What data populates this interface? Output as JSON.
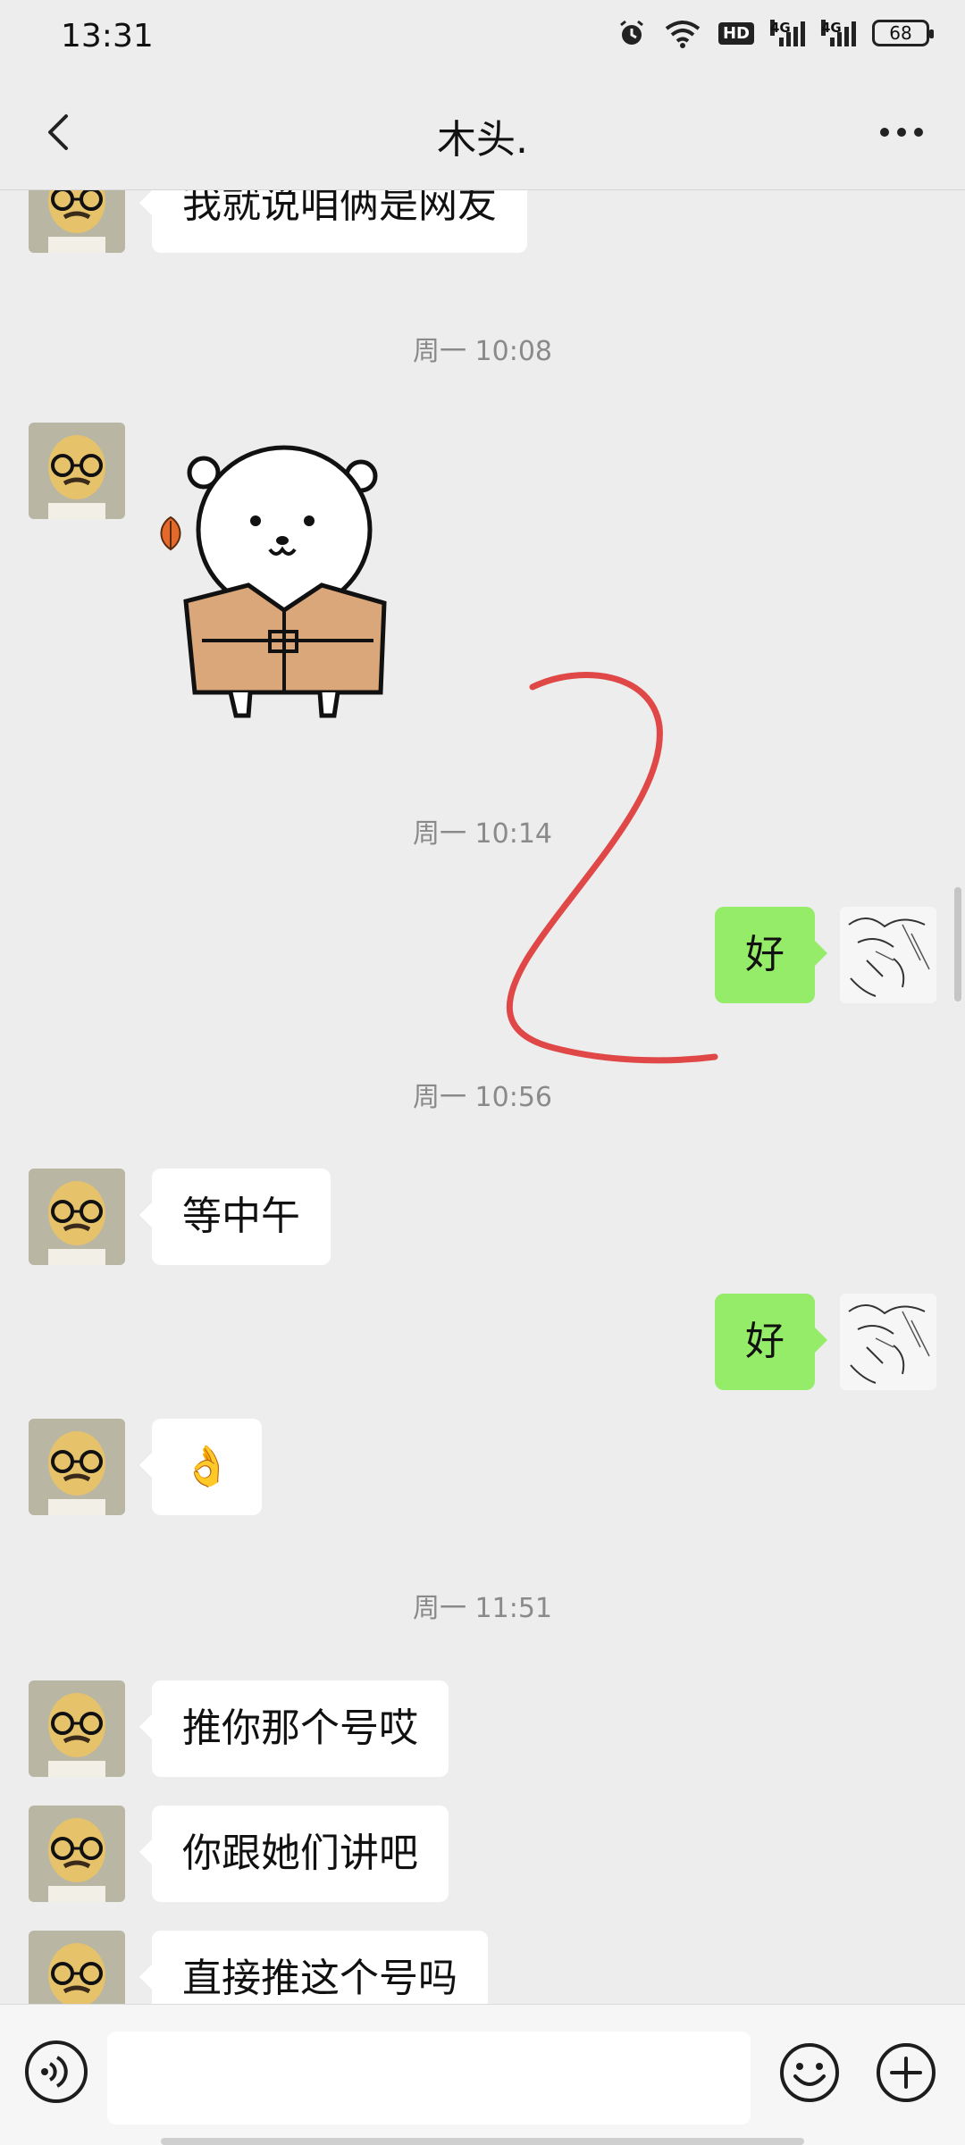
{
  "status": {
    "time": "13:31",
    "battery": "68",
    "hd_badge": "HD",
    "net_left": "4G",
    "net_right": "4G"
  },
  "nav": {
    "title": "木头."
  },
  "messages": [
    {
      "side": "left",
      "text": "我就说咱俩是网友"
    },
    {
      "timestamp": "周一 10:08"
    },
    {
      "side": "left",
      "kind": "sticker"
    },
    {
      "timestamp": "周一 10:14"
    },
    {
      "side": "right",
      "text": "好"
    },
    {
      "timestamp": "周一 10:56"
    },
    {
      "side": "left",
      "text": "等中午"
    },
    {
      "side": "right",
      "text": "好"
    },
    {
      "side": "left",
      "text": "👌"
    },
    {
      "timestamp": "周一 11:51"
    },
    {
      "side": "left",
      "text": "推你那个号哎"
    },
    {
      "side": "left",
      "text": "你跟她们讲吧"
    },
    {
      "side": "left",
      "text": "直接推这个号吗"
    }
  ],
  "input": {
    "value": ""
  },
  "colors": {
    "background": "#ededed",
    "bubble_right": "#95ec69",
    "bubble_left": "#ffffff",
    "annotation": "#e04848"
  }
}
